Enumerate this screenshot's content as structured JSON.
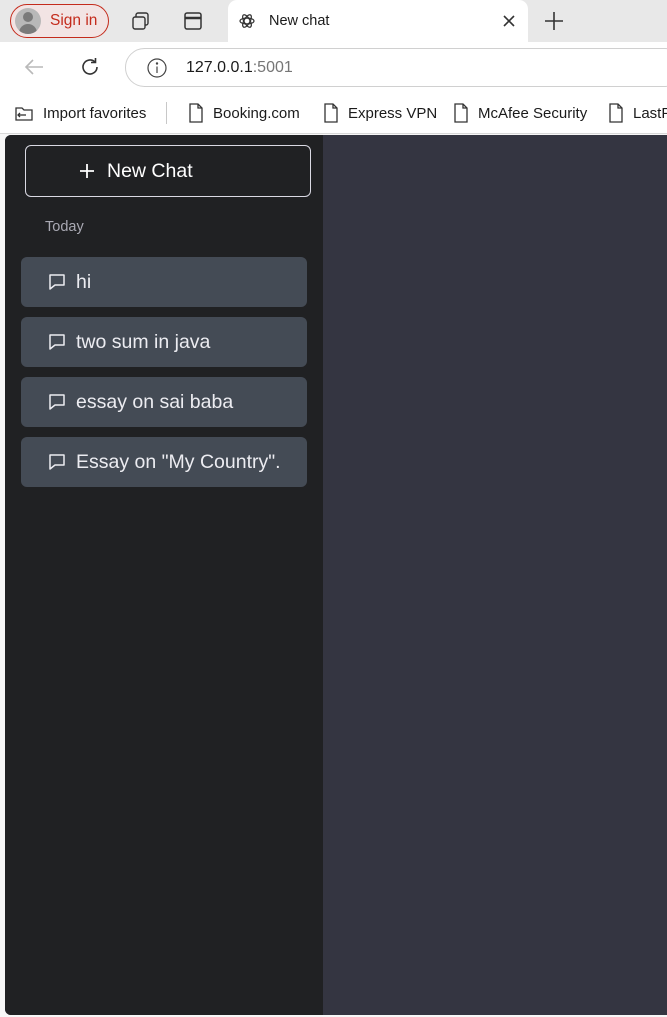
{
  "browser": {
    "signin_label": "Sign in",
    "active_tab": {
      "title": "New chat",
      "favicon": "openai-icon"
    },
    "url": {
      "host": "127.0.0.1",
      "port": ":5001"
    },
    "favorites": [
      {
        "label": "Import favorites",
        "icon": "import-favorites-icon"
      },
      {
        "label": "Booking.com",
        "icon": "page-icon"
      },
      {
        "label": "Express VPN",
        "icon": "page-icon"
      },
      {
        "label": "McAfee Security",
        "icon": "page-icon"
      },
      {
        "label": "LastP",
        "icon": "page-icon"
      }
    ]
  },
  "sidebar": {
    "new_chat_label": "New Chat",
    "section_label": "Today",
    "chats": [
      {
        "title": "hi"
      },
      {
        "title": "two sum in java"
      },
      {
        "title": "essay on sai baba"
      },
      {
        "title": "Essay on \"My Country\"."
      }
    ]
  },
  "colors": {
    "sidebar_bg": "#202123",
    "main_bg": "#343541",
    "chat_item_bg": "#444b55",
    "signin_accent": "#c42b1c"
  }
}
